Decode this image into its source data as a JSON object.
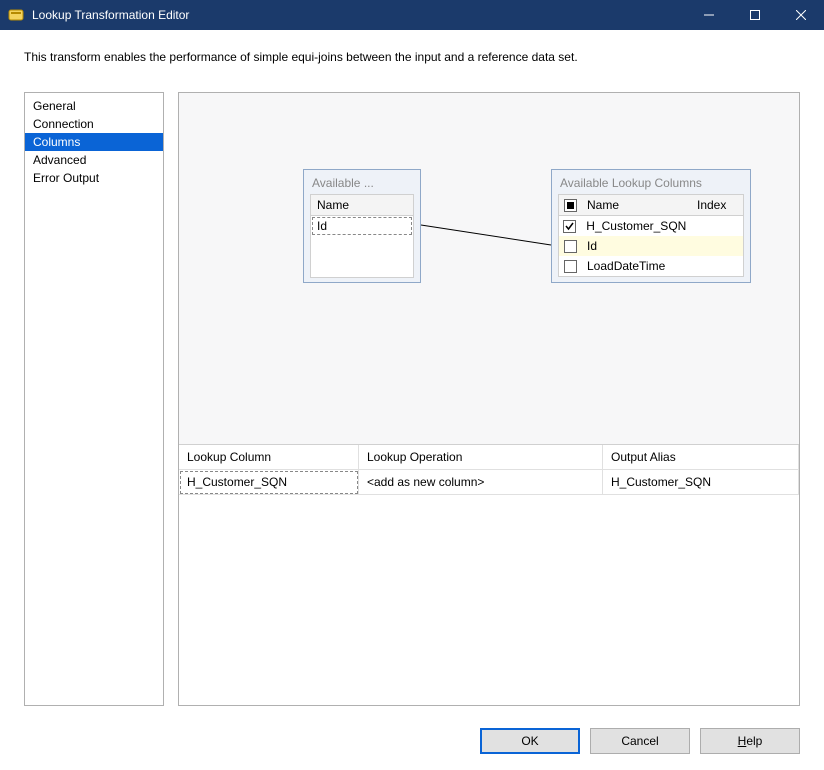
{
  "window": {
    "title": "Lookup Transformation Editor"
  },
  "description": "This transform enables the performance of simple equi-joins between the input and a reference data set.",
  "nav": {
    "items": [
      "General",
      "Connection",
      "Columns",
      "Advanced",
      "Error Output"
    ],
    "selected_index": 2
  },
  "input_box": {
    "title": "Available ...",
    "header": "Name",
    "rows": [
      "Id"
    ]
  },
  "lookup_box": {
    "title": "Available Lookup Columns",
    "header_name": "Name",
    "header_index": "Index",
    "rows": [
      {
        "name": "H_Customer_SQN",
        "checked": true,
        "highlight": false
      },
      {
        "name": "Id",
        "checked": false,
        "highlight": true
      },
      {
        "name": "LoadDateTime",
        "checked": false,
        "highlight": false
      }
    ]
  },
  "mapping": {
    "headers": [
      "Lookup Column",
      "Lookup Operation",
      "Output Alias"
    ],
    "rows": [
      {
        "column": "H_Customer_SQN",
        "operation": "<add as new column>",
        "alias": "H_Customer_SQN"
      }
    ]
  },
  "buttons": {
    "ok": "OK",
    "cancel": "Cancel",
    "help": "Help"
  }
}
